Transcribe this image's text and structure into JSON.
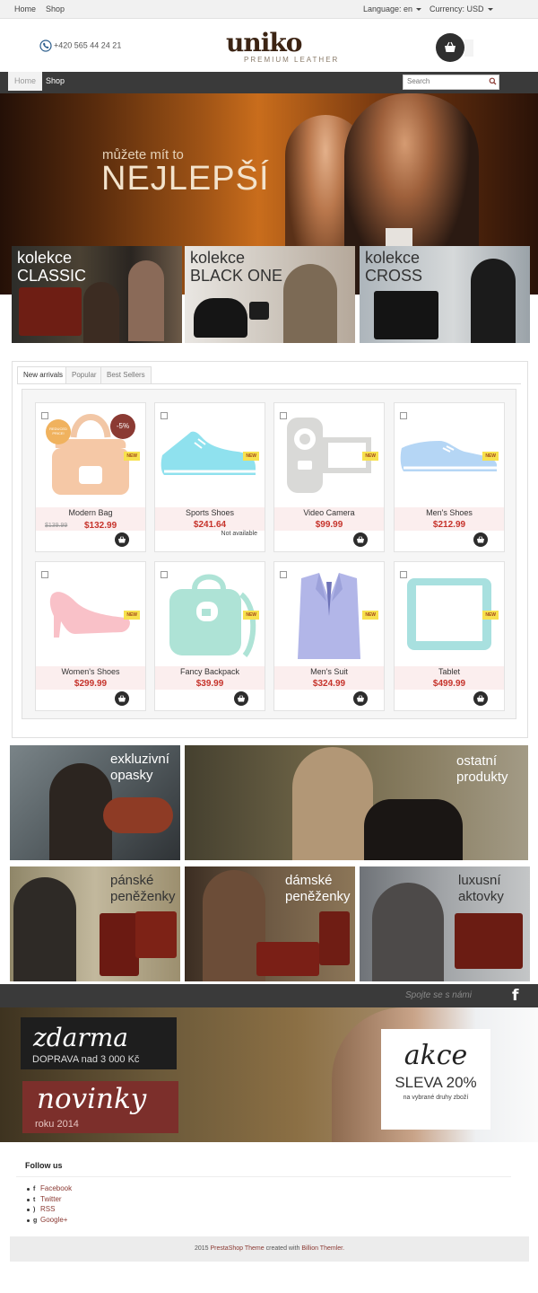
{
  "topbar": {
    "home": "Home",
    "shop": "Shop",
    "language_label": "Language: en",
    "currency_label": "Currency: USD"
  },
  "header": {
    "phone": "+420 565 44 24 21",
    "logo_word": "uniko",
    "logo_tagline": "PREMIUM LEATHER"
  },
  "nav": {
    "items": [
      {
        "label": "Home"
      },
      {
        "label": "Shop"
      }
    ],
    "search_placeholder": "Search"
  },
  "hero": {
    "line1": "můžete mít to",
    "line2": "NEJLEPŠÍ"
  },
  "collections": [
    {
      "line1": "kolekce",
      "line2": "CLASSIC"
    },
    {
      "line1": "kolekce",
      "line2": "BLACK ONE"
    },
    {
      "line1": "kolekce",
      "line2": "CROSS"
    }
  ],
  "tabs": [
    {
      "label": "New arrivals"
    },
    {
      "label": "Popular"
    },
    {
      "label": "Best Sellers"
    }
  ],
  "products": [
    {
      "name": "Modern Bag",
      "price": "$132.99",
      "old_price": "$139.99",
      "discount": "-5%",
      "reduced": "REDUCED PRICE!",
      "new_label": "NEW"
    },
    {
      "name": "Sports Shoes",
      "price": "$241.64",
      "availability": "Not available",
      "new_label": "NEW"
    },
    {
      "name": "Video Camera",
      "price": "$99.99",
      "new_label": "NEW"
    },
    {
      "name": "Men's Shoes",
      "price": "$212.99",
      "new_label": "NEW"
    },
    {
      "name": "Women's Shoes",
      "price": "$299.99",
      "new_label": "NEW"
    },
    {
      "name": "Fancy Backpack",
      "price": "$39.99",
      "new_label": "NEW"
    },
    {
      "name": "Men's Suit",
      "price": "$324.99",
      "new_label": "NEW"
    },
    {
      "name": "Tablet",
      "price": "$499.99",
      "new_label": "NEW"
    }
  ],
  "promos": [
    {
      "line1": "exkluzivní",
      "line2": "opasky"
    },
    {
      "line1": "ostatní",
      "line2": "produkty"
    },
    {
      "line1": "pánské",
      "line2": "peněženky"
    },
    {
      "line1": "dámské",
      "line2": "peněženky"
    },
    {
      "line1": "luxusní",
      "line2": "aktovky"
    }
  ],
  "strip": {
    "text": "Spojte se s námi"
  },
  "banner": {
    "zdarma_title": "zdarma",
    "zdarma_sub": "DOPRAVA nad 3 000 Kč",
    "novinky_title": "novinky",
    "novinky_sub": "roku 2014",
    "akce_title": "akce",
    "akce_sub": "SLEVA 20%",
    "akce_note": "na vybrané druhy zboží"
  },
  "follow": {
    "title": "Follow us",
    "links": [
      {
        "label": "Facebook",
        "icon": "facebook-icon"
      },
      {
        "label": "Twitter",
        "icon": "twitter-icon"
      },
      {
        "label": "RSS",
        "icon": "rss-icon"
      },
      {
        "label": "Google+",
        "icon": "google-plus-icon"
      }
    ]
  },
  "footer": {
    "year": "2015",
    "brand": "PrestaShop Theme",
    "middle": "created with",
    "author": "Billion Themler."
  },
  "colors": {
    "accent_red": "#c6332b",
    "dark": "#3a3a3a",
    "brand_brown": "#3c2414"
  }
}
